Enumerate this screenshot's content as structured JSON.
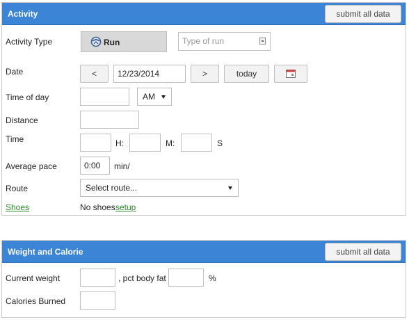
{
  "activity": {
    "title": "Activity",
    "submit_label": "submit all data",
    "activity_type_label": "Activity Type",
    "activity_type_value": "Run",
    "type_of_run_placeholder": "Type of run",
    "date_label": "Date",
    "prev_label": "<",
    "date_value": "12/23/2014",
    "next_label": ">",
    "today_label": "today",
    "time_of_day_label": "Time of day",
    "ampm_value": "AM",
    "distance_label": "Distance",
    "time_label": "Time",
    "h_label": "H:",
    "m_label": "M:",
    "s_label": "S",
    "average_pace_label": "Average pace",
    "pace_value": "0:00",
    "pace_unit": "min/",
    "route_label": "Route",
    "route_value": "Select route...",
    "shoes_label": "Shoes",
    "no_shoes_text": "No shoes",
    "setup_link": "setup"
  },
  "weight": {
    "title": "Weight and Calorie",
    "submit_label": "submit all data",
    "current_weight_label": "Current weight",
    "pct_body_fat_label": ", pct body fat",
    "percent_symbol": "%",
    "calories_label": "Calories Burned"
  },
  "colors": {
    "header_blue": "#3c85d6",
    "link_green": "#2e8b2e"
  }
}
